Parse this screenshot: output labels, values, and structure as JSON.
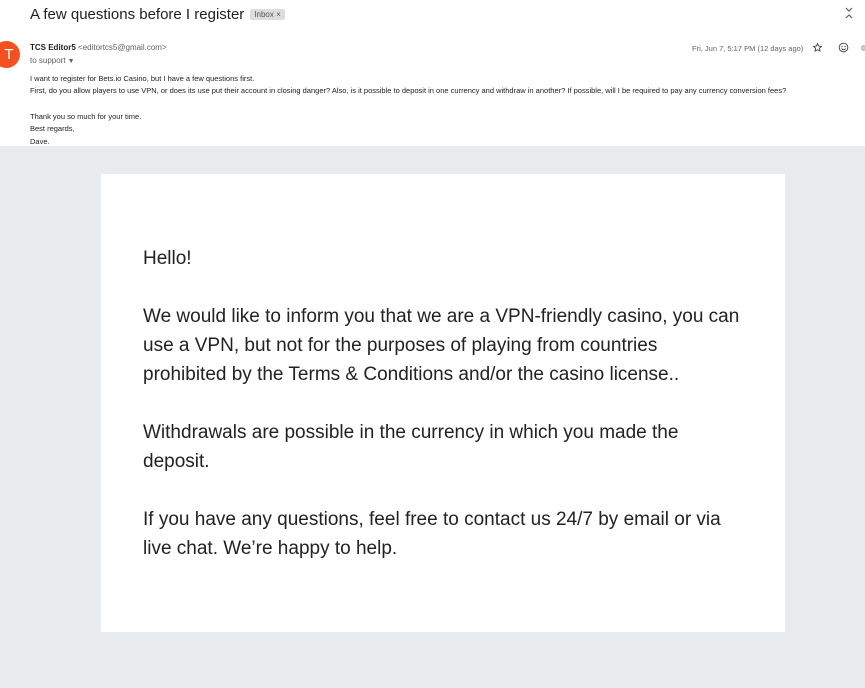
{
  "email": {
    "subject": "A few questions before I register",
    "label": "Inbox ×",
    "sender_name": "TCS Editor5",
    "sender_email": "<editortcs5@gmail.com>",
    "avatar_letter": "T",
    "to_line": "to support",
    "date": "Fri, Jun 7, 5:17 PM (12 days ago)",
    "body": {
      "line1": "I want to register for Bets.io Casino, but I have a few questions first.",
      "line2": "First, do you allow players to use VPN, or does its use put their account in closing danger? Also, is it possible to deposit in one currency and withdraw in another? If possible, will I be required to pay any currency conversion fees?",
      "line3": "Thank you so much for your time.",
      "line4": "Best regards,",
      "line5": "Dave."
    }
  },
  "reply": {
    "greeting": "Hello!",
    "paragraph1": "We would like to inform you that we are a VPN-friendly casino, you can use a VPN, but not for the purposes of playing from countries prohibited by the Terms & Conditions and/or the casino license..",
    "paragraph2": "Withdrawals are possible in the currency in which you made the deposit.",
    "paragraph3": "If you have any questions, feel free to contact us 24/7 by email or via live chat. We’re happy to help."
  },
  "icons": {
    "expand": "unfold-icon",
    "star": "star-icon",
    "emoji": "emoji-icon"
  },
  "colors": {
    "avatar": "#f4511e",
    "reply_background": "#e9ecef",
    "card": "#ffffff"
  }
}
